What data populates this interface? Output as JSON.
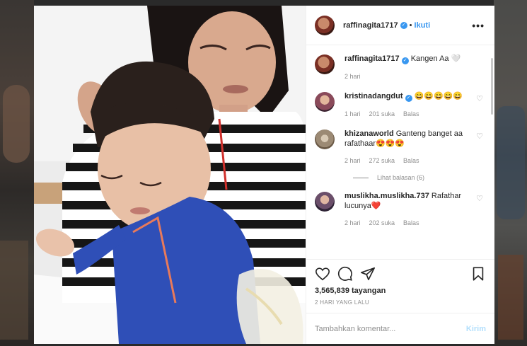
{
  "post": {
    "username": "raffinagita1717",
    "verified_badge": "✓",
    "separator": "•",
    "follow_label": "Ikuti",
    "more_icon": "•••",
    "caption": {
      "username": "raffinagita1717",
      "text": "Kangen Aa 🤍",
      "time": "2 hari"
    }
  },
  "comments": [
    {
      "username": "kristinadangdut",
      "verified": true,
      "text": "😄😄😄😄😄",
      "time": "1 hari",
      "likes": "201 suka",
      "reply_label": "Balas"
    },
    {
      "username": "khizanaworld",
      "verified": false,
      "text": "Ganteng banget aa rafathaar😍😍😍",
      "time": "2 hari",
      "likes": "272 suka",
      "reply_label": "Balas",
      "view_replies": "Lihat balasan (6)"
    },
    {
      "username": "muslikha.muslikha.737",
      "verified": false,
      "text": "Rafathar lucunya❤️",
      "time": "2 hari",
      "likes": "202 suka",
      "reply_label": "Balas"
    }
  ],
  "stats": {
    "views": "3,565,839 tayangan",
    "date": "2 HARI YANG LALU"
  },
  "composer": {
    "placeholder": "Tambahkan komentar...",
    "send_label": "Kirim"
  },
  "icons": {
    "like": "heart-icon",
    "comment": "comment-icon",
    "share": "share-icon",
    "save": "bookmark-icon",
    "comment_like": "heart-outline-icon"
  },
  "colors": {
    "link_blue": "#3897f0",
    "send_disabled": "#b2dffc",
    "meta_gray": "#8e8e8e",
    "text": "#262626"
  }
}
